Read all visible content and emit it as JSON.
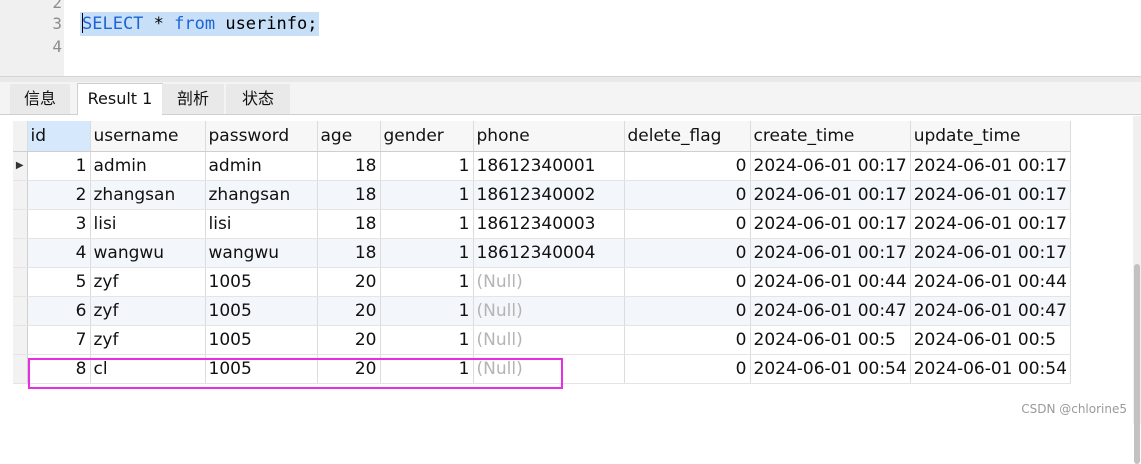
{
  "editor": {
    "lines": [
      {
        "num": "2"
      },
      {
        "num": "3"
      },
      {
        "num": "4"
      }
    ],
    "query": {
      "kw_select": "SELECT",
      "star": " * ",
      "kw_from": "from",
      "rest": " userinfo;"
    }
  },
  "tabs": [
    {
      "label": "信息"
    },
    {
      "label": "Result 1"
    },
    {
      "label": "剖析"
    },
    {
      "label": "状态"
    }
  ],
  "active_tab": "Result 1",
  "grid": {
    "columns": [
      "id",
      "username",
      "password",
      "age",
      "gender",
      "phone",
      "delete_flag",
      "create_time",
      "update_time"
    ],
    "rows": [
      [
        "1",
        "admin",
        "admin",
        "18",
        "1",
        "18612340001",
        "0",
        "2024-06-01 00:17",
        "2024-06-01 00:17"
      ],
      [
        "2",
        "zhangsan",
        "zhangsan",
        "18",
        "1",
        "18612340002",
        "0",
        "2024-06-01 00:17",
        "2024-06-01 00:17"
      ],
      [
        "3",
        "lisi",
        "lisi",
        "18",
        "1",
        "18612340003",
        "0",
        "2024-06-01 00:17",
        "2024-06-01 00:17"
      ],
      [
        "4",
        "wangwu",
        "wangwu",
        "18",
        "1",
        "18612340004",
        "0",
        "2024-06-01 00:17",
        "2024-06-01 00:17"
      ],
      [
        "5",
        "zyf",
        "1005",
        "20",
        "1",
        "(Null)",
        "0",
        "2024-06-01 00:44",
        "2024-06-01 00:44"
      ],
      [
        "6",
        "zyf",
        "1005",
        "20",
        "1",
        "(Null)",
        "0",
        "2024-06-01 00:47",
        "2024-06-01 00:47"
      ],
      [
        "7",
        "zyf",
        "1005",
        "20",
        "1",
        "(Null)",
        "0",
        "2024-06-01 00:5",
        "2024-06-01 00:5"
      ],
      [
        "8",
        "cl",
        "1005",
        "20",
        "1",
        "(Null)",
        "0",
        "2024-06-01 00:54",
        "2024-06-01 00:54"
      ]
    ],
    "current_row_indicator": "▶",
    "highlighted_row": 8
  },
  "watermark": "CSDN @chlorine5",
  "colors": {
    "keyword": "#1e64d6",
    "selection": "#c7dff7",
    "highlight_box": "#e62ee6",
    "null_text": "#b4b4b4"
  }
}
